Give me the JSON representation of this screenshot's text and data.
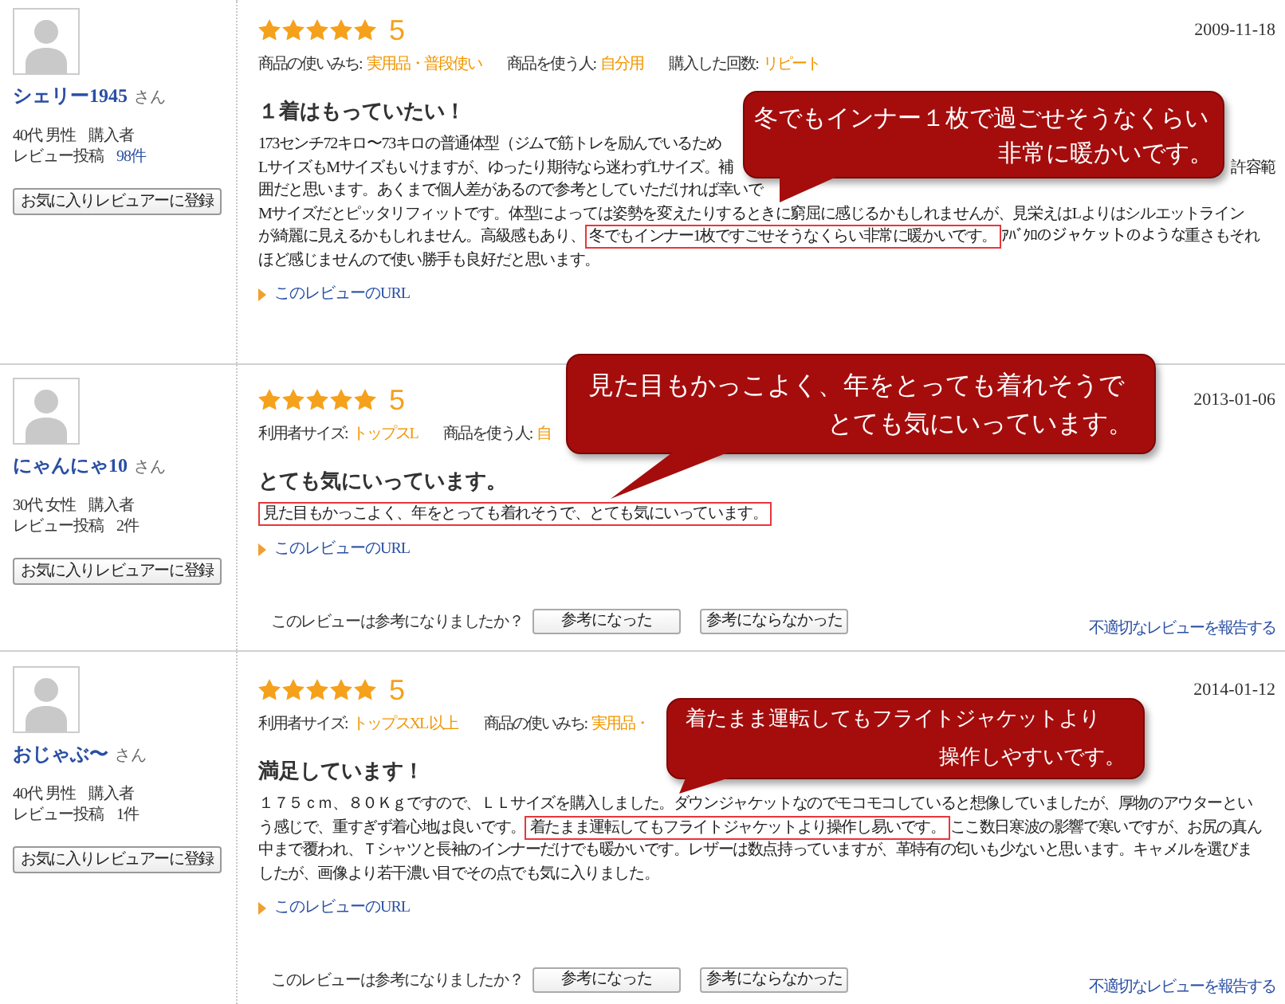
{
  "reviews": [
    {
      "reviewer": {
        "name": "シェリー1945",
        "honorific": "さん",
        "demographics": "40代 男性",
        "buyer_label": "購入者",
        "posts_label": "レビュー投稿",
        "posts_count": "98件",
        "posts_count_linked": true
      },
      "favorite_button": "お気に入りレビュアーに登録",
      "stars": 5,
      "score": "5",
      "date": "2009-11-18",
      "attributes": [
        {
          "label": "商品の使いみち:",
          "value": "実用品・普段使い"
        },
        {
          "label": "商品を使う人:",
          "value": "自分用"
        },
        {
          "label": "購入した回数:",
          "value": "リピート"
        }
      ],
      "title": "１着はもっていたい！",
      "lines": [
        {
          "segments": [
            {
              "text": "173センチ72キロ〜73キロの普通体型（ジムで筋トレを励んでいるため",
              "highlighted": false
            }
          ]
        },
        {
          "segments": [
            {
              "text": "LサイズもMサイズもいけますが、ゆったり期待なら迷わずLサイズ。補",
              "highlighted": false
            }
          ],
          "right_text": "許容範"
        },
        {
          "segments": [
            {
              "text": "囲だと思います。あくまで個人差があるので参考としていただければ幸いで",
              "highlighted": false
            }
          ]
        },
        {
          "segments": [
            {
              "text": "Mサイズだとピッタリフィットです。体型によっては姿勢を変えたりするときに窮屈に感じるかもしれませんが、見栄えはLよりはシルエットライン",
              "highlighted": false
            }
          ]
        },
        {
          "segments": [
            {
              "text": "が綺麗に見えるかもしれません。高級感もあり、",
              "highlighted": false
            },
            {
              "text": "冬でもインナー1枚ですごせそうなくらい非常に暖かいです。",
              "highlighted": true
            },
            {
              "text": "ｱﾊﾞｸﾛのジャケットのような重さもそれ",
              "highlighted": false
            }
          ]
        },
        {
          "segments": [
            {
              "text": "ほど感じませんので使い勝手も良好だと思います。",
              "highlighted": false
            }
          ]
        }
      ],
      "url_link": "このレビューのURL",
      "callout": [
        "冬でもインナー１枚で過ごせそうなくらい",
        "非常に暖かいです。"
      ]
    },
    {
      "reviewer": {
        "name": "にゃんにゃ10",
        "honorific": "さん",
        "demographics": "30代 女性",
        "buyer_label": "購入者",
        "posts_label": "レビュー投稿",
        "posts_count": "2件",
        "posts_count_linked": false
      },
      "favorite_button": "お気に入りレビュアーに登録",
      "stars": 5,
      "score": "5",
      "date": "2013-01-06",
      "attributes": [
        {
          "label": "利用者サイズ:",
          "value": "トップスL"
        },
        {
          "label": "商品を使う人:",
          "value": "自"
        }
      ],
      "title": "とても気にいっています。",
      "lines": [
        {
          "segments": [
            {
              "text": "見た目もかっこよく、年をとっても着れそうで、とても気にいっています。",
              "highlighted": true
            }
          ]
        }
      ],
      "url_link": "このレビューのURL",
      "feedback": {
        "question": "このレビューは参考になりましたか？",
        "buttons": [
          "参考になった",
          "参考にならなかった"
        ],
        "report_link": "不適切なレビューを報告する"
      },
      "callout": [
        "見た目もかっこよく、年をとっても着れそうで",
        "とても気にいっています。"
      ]
    },
    {
      "reviewer": {
        "name": "おじゃぶ〜",
        "honorific": "さん",
        "demographics": "40代 男性",
        "buyer_label": "購入者",
        "posts_label": "レビュー投稿",
        "posts_count": "1件",
        "posts_count_linked": false
      },
      "favorite_button": "お気に入りレビュアーに登録",
      "stars": 5,
      "score": "5",
      "date": "2014-01-12",
      "attributes": [
        {
          "label": "利用者サイズ:",
          "value": "トップスXL 以上"
        },
        {
          "label": "商品の使いみち:",
          "value": "実用品・"
        }
      ],
      "title": "満足しています！",
      "lines": [
        {
          "segments": [
            {
              "text": "１７５ｃｍ、８０Ｋｇですので、ＬＬサイズを購入しました。ダウンジャケットなのでモコモコしていると想像していましたが、厚物のアウターとい",
              "highlighted": false
            }
          ]
        },
        {
          "segments": [
            {
              "text": "う感じで、重すぎず着心地は良いです。",
              "highlighted": false
            },
            {
              "text": "着たまま運転してもフライトジャケットより操作し易いです。",
              "highlighted": true
            },
            {
              "text": "ここ数日寒波の影響で寒いですが、お尻の真ん",
              "highlighted": false
            }
          ]
        },
        {
          "segments": [
            {
              "text": "中まで覆われ、Ｔシャツと長袖のインナーだけでも暖かいです。レザーは数点持っていますが、革特有の匂いも少ないと思います。キャメルを選びま",
              "highlighted": false
            }
          ]
        },
        {
          "segments": [
            {
              "text": "したが、画像より若干濃い目でその点でも気に入りました。",
              "highlighted": false
            }
          ]
        }
      ],
      "url_link": "このレビューのURL",
      "feedback": {
        "question": "このレビューは参考になりましたか？",
        "buttons": [
          "参考になった",
          "参考にならなかった"
        ],
        "report_link": "不適切なレビューを報告する"
      },
      "callout": [
        "着たまま運転してもフライトジャケットより",
        "操作しやすいです。"
      ]
    }
  ]
}
